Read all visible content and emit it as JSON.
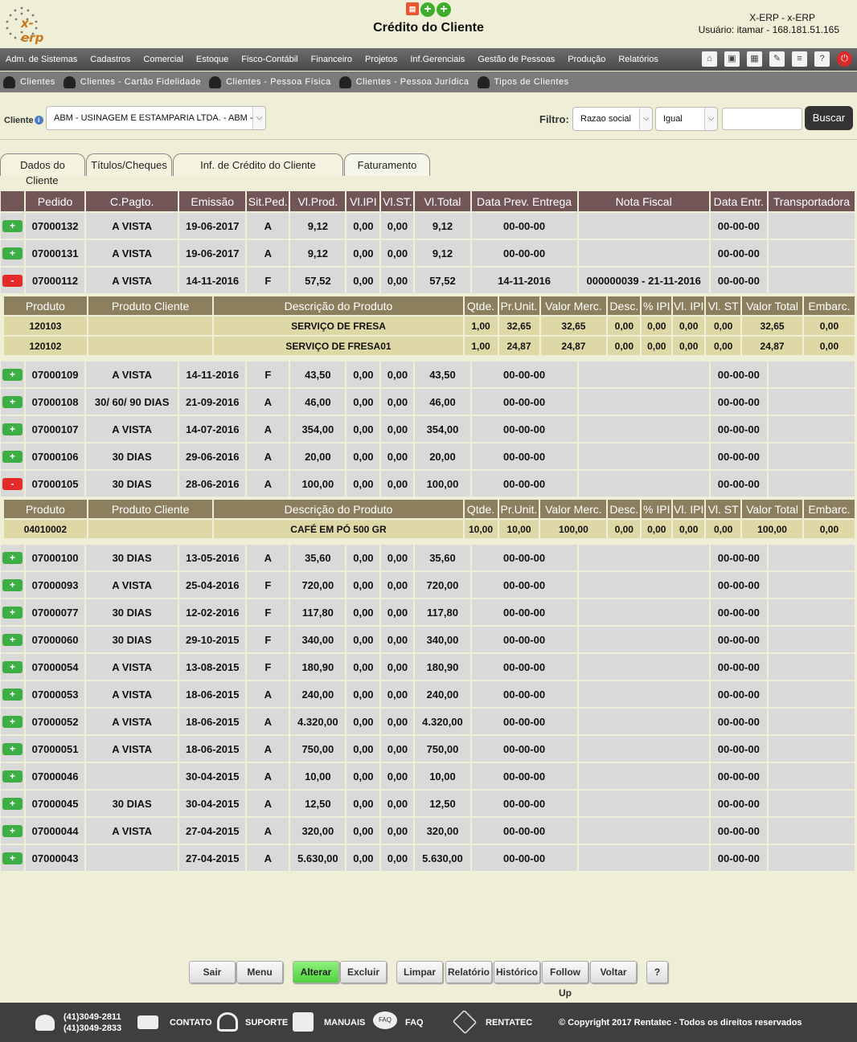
{
  "header": {
    "logo_text": "x-erp",
    "title": "Crédito do Cliente",
    "user_line1": "X-ERP - x-ERP",
    "user_line2": "Usuário: itamar - 168.181.51.165"
  },
  "menu": [
    "Adm. de Sistemas",
    "Cadastros",
    "Comercial",
    "Estoque",
    "Fisco-Contábil",
    "Financeiro",
    "Projetos",
    "Inf.Gerenciais",
    "Gestão de Pessoas",
    "Produção",
    "Relatórios"
  ],
  "submenu": [
    "Clientes",
    "Clientes - Cartão Fidelidade",
    "Clientes - Pessoa Física",
    "Clientes - Pessoa Jurídica",
    "Tipos de Clientes"
  ],
  "filter": {
    "cliente_label": "Cliente",
    "cliente_value": "ABM - USINAGEM E ESTAMPARIA LTDA. - ABM - (",
    "filtro_label": "Filtro:",
    "campo": "Razao social",
    "operador": "Igual",
    "search_value": "",
    "buscar": "Buscar"
  },
  "tabs": {
    "dados_line1": "Dados do",
    "dados_line2": "Cliente",
    "titulos": "Títulos/Cheques",
    "credito": "Inf. de Crédito do Cliente",
    "faturamento": "Faturamento"
  },
  "orders_headers": [
    "",
    "Pedido",
    "C.Pagto.",
    "Emissão",
    "Sit.Ped.",
    "Vl.Prod.",
    "Vl.IPI",
    "Vl.ST.",
    "Vl.Total",
    "Data Prev. Entrega",
    "Nota Fiscal",
    "Data Entr.",
    "Transportadora"
  ],
  "product_headers": [
    "Produto",
    "Produto Cliente",
    "Descrição do Produto",
    "Qtde.",
    "Pr.Unit.",
    "Valor Merc.",
    "Desc.",
    "% IPI",
    "Vl. IPI",
    "Vl. ST",
    "Valor Total",
    "Embarc."
  ],
  "orders": [
    {
      "btn": "+",
      "cells": [
        "07000132",
        "A VISTA",
        "19-06-2017",
        "A",
        "9,12",
        "0,00",
        "0,00",
        "9,12",
        "00-00-00",
        "",
        "00-00-00",
        ""
      ]
    },
    {
      "btn": "+",
      "cells": [
        "07000131",
        "A VISTA",
        "19-06-2017",
        "A",
        "9,12",
        "0,00",
        "0,00",
        "9,12",
        "00-00-00",
        "",
        "00-00-00",
        ""
      ]
    },
    {
      "btn": "-",
      "cells": [
        "07000112",
        "A VISTA",
        "14-11-2016",
        "F",
        "57,52",
        "0,00",
        "0,00",
        "57,52",
        "14-11-2016",
        "000000039 - 21-11-2016",
        "00-00-00",
        ""
      ],
      "products": [
        [
          "120103",
          "",
          "SERVIÇO DE FRESA",
          "1,00",
          "32,65",
          "32,65",
          "0,00",
          "0,00",
          "0,00",
          "0,00",
          "32,65",
          "0,00"
        ],
        [
          "120102",
          "",
          "SERVIÇO DE FRESA01",
          "1,00",
          "24,87",
          "24,87",
          "0,00",
          "0,00",
          "0,00",
          "0,00",
          "24,87",
          "0,00"
        ]
      ]
    },
    {
      "btn": "+",
      "cells": [
        "07000109",
        "A VISTA",
        "14-11-2016",
        "F",
        "43,50",
        "0,00",
        "0,00",
        "43,50",
        "00-00-00",
        "",
        "00-00-00",
        ""
      ]
    },
    {
      "btn": "+",
      "cells": [
        "07000108",
        "30/ 60/ 90 DIAS",
        "21-09-2016",
        "A",
        "46,00",
        "0,00",
        "0,00",
        "46,00",
        "00-00-00",
        "",
        "00-00-00",
        ""
      ]
    },
    {
      "btn": "+",
      "cells": [
        "07000107",
        "A VISTA",
        "14-07-2016",
        "A",
        "354,00",
        "0,00",
        "0,00",
        "354,00",
        "00-00-00",
        "",
        "00-00-00",
        ""
      ]
    },
    {
      "btn": "+",
      "cells": [
        "07000106",
        "30 DIAS",
        "29-06-2016",
        "A",
        "20,00",
        "0,00",
        "0,00",
        "20,00",
        "00-00-00",
        "",
        "00-00-00",
        ""
      ]
    },
    {
      "btn": "-",
      "cells": [
        "07000105",
        "30 DIAS",
        "28-06-2016",
        "A",
        "100,00",
        "0,00",
        "0,00",
        "100,00",
        "00-00-00",
        "",
        "00-00-00",
        ""
      ],
      "products": [
        [
          "04010002",
          "",
          "CAFÉ EM PÓ 500 GR",
          "10,00",
          "10,00",
          "100,00",
          "0,00",
          "0,00",
          "0,00",
          "0,00",
          "100,00",
          "0,00"
        ]
      ]
    },
    {
      "btn": "+",
      "cells": [
        "07000100",
        "30 DIAS",
        "13-05-2016",
        "A",
        "35,60",
        "0,00",
        "0,00",
        "35,60",
        "00-00-00",
        "",
        "00-00-00",
        ""
      ]
    },
    {
      "btn": "+",
      "cells": [
        "07000093",
        "A VISTA",
        "25-04-2016",
        "F",
        "720,00",
        "0,00",
        "0,00",
        "720,00",
        "00-00-00",
        "",
        "00-00-00",
        ""
      ]
    },
    {
      "btn": "+",
      "cells": [
        "07000077",
        "30 DIAS",
        "12-02-2016",
        "F",
        "117,80",
        "0,00",
        "0,00",
        "117,80",
        "00-00-00",
        "",
        "00-00-00",
        ""
      ]
    },
    {
      "btn": "+",
      "cells": [
        "07000060",
        "30 DIAS",
        "29-10-2015",
        "F",
        "340,00",
        "0,00",
        "0,00",
        "340,00",
        "00-00-00",
        "",
        "00-00-00",
        ""
      ]
    },
    {
      "btn": "+",
      "cells": [
        "07000054",
        "A VISTA",
        "13-08-2015",
        "F",
        "180,90",
        "0,00",
        "0,00",
        "180,90",
        "00-00-00",
        "",
        "00-00-00",
        ""
      ]
    },
    {
      "btn": "+",
      "cells": [
        "07000053",
        "A VISTA",
        "18-06-2015",
        "A",
        "240,00",
        "0,00",
        "0,00",
        "240,00",
        "00-00-00",
        "",
        "00-00-00",
        ""
      ]
    },
    {
      "btn": "+",
      "cells": [
        "07000052",
        "A VISTA",
        "18-06-2015",
        "A",
        "4.320,00",
        "0,00",
        "0,00",
        "4.320,00",
        "00-00-00",
        "",
        "00-00-00",
        ""
      ]
    },
    {
      "btn": "+",
      "cells": [
        "07000051",
        "A VISTA",
        "18-06-2015",
        "A",
        "750,00",
        "0,00",
        "0,00",
        "750,00",
        "00-00-00",
        "",
        "00-00-00",
        ""
      ]
    },
    {
      "btn": "+",
      "cells": [
        "07000046",
        "",
        "30-04-2015",
        "A",
        "10,00",
        "0,00",
        "0,00",
        "10,00",
        "00-00-00",
        "",
        "00-00-00",
        ""
      ]
    },
    {
      "btn": "+",
      "cells": [
        "07000045",
        "30 DIAS",
        "30-04-2015",
        "A",
        "12,50",
        "0,00",
        "0,00",
        "12,50",
        "00-00-00",
        "",
        "00-00-00",
        ""
      ]
    },
    {
      "btn": "+",
      "cells": [
        "07000044",
        "A VISTA",
        "27-04-2015",
        "A",
        "320,00",
        "0,00",
        "0,00",
        "320,00",
        "00-00-00",
        "",
        "00-00-00",
        ""
      ]
    },
    {
      "btn": "+",
      "cells": [
        "07000043",
        "",
        "27-04-2015",
        "A",
        "5.630,00",
        "0,00",
        "0,00",
        "5.630,00",
        "00-00-00",
        "",
        "00-00-00",
        ""
      ]
    }
  ],
  "buttons": {
    "sair": "Sair",
    "menu": "Menu",
    "alterar": "Alterar",
    "excluir": "Excluir",
    "limpar": "Limpar",
    "relatorio": "Relatório",
    "historico": "Histórico",
    "followup": "Follow Up",
    "voltar": "Voltar",
    "help": "?"
  },
  "footer": {
    "phone1": "(41)3049-2811",
    "phone2": "(41)3049-2833",
    "contato": "CONTATO",
    "suporte": "SUPORTE",
    "manuais": "MANUAIS",
    "faq_badge": "FAQ",
    "faq": "FAQ",
    "rentatec": "RENTATEC",
    "copyright": "© Copyright 2017 Rentatec - Todos os direitos reservados"
  },
  "colors": {
    "background": "#efefd8",
    "orders_header": "#725557",
    "products_header": "#8b7f5e",
    "products_row": "#ded8a6",
    "plus_button": "#3cae44",
    "minus_button": "#e52a2a",
    "alterar_button": "#4fd23e"
  }
}
